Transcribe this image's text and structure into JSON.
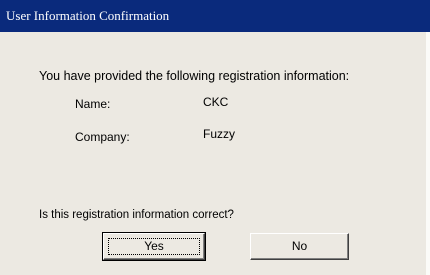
{
  "window": {
    "title": "User Information Confirmation"
  },
  "content": {
    "intro_message": "You have provided the following registration information:",
    "fields": {
      "name_label": "Name:",
      "name_value": "CKC",
      "company_label": "Company:",
      "company_value": "Fuzzy"
    },
    "question": "Is this registration information correct?"
  },
  "buttons": {
    "yes_label": "Yes",
    "no_label": "No"
  },
  "colors": {
    "titlebar": "#0a2a7c",
    "background": "#ece9e2"
  }
}
